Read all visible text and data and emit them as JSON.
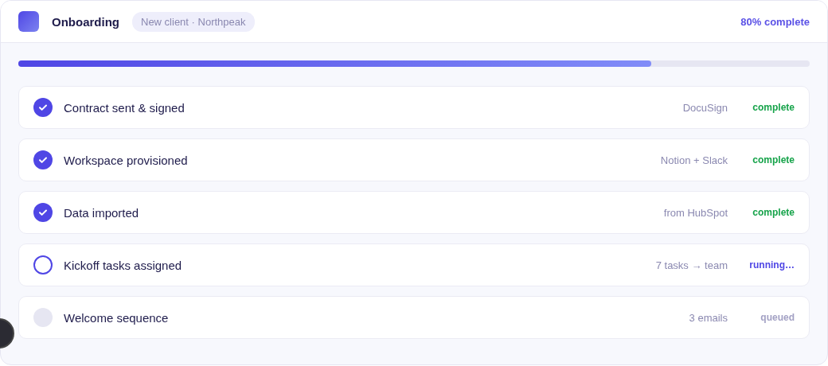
{
  "header": {
    "title": "Onboarding",
    "tag": "New client · Northpeak",
    "progress_label": "80% complete"
  },
  "progress": {
    "level": 0.8
  },
  "steps": [
    {
      "title": "Contract sent & signed",
      "detail": "DocuSign",
      "status": "complete",
      "kind": "done"
    },
    {
      "title": "Workspace provisioned",
      "detail": "Notion + Slack",
      "status": "complete",
      "kind": "done"
    },
    {
      "title": "Data imported",
      "detail": "from HubSpot",
      "status": "complete",
      "kind": "done"
    },
    {
      "title": "Kickoff tasks assigned",
      "detail": "7 tasks → team",
      "status": "running…",
      "kind": "active"
    },
    {
      "title": "Welcome sequence",
      "detail": "3 emails",
      "status": "queued",
      "kind": "pending"
    }
  ]
}
